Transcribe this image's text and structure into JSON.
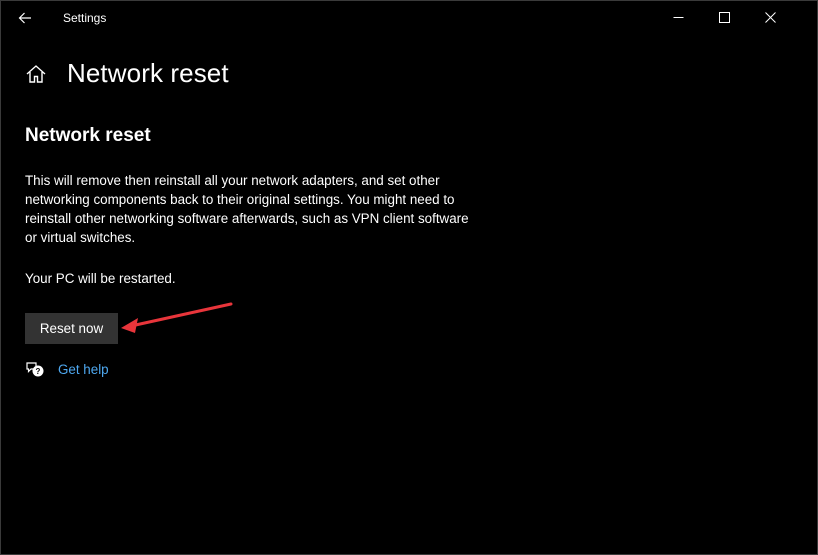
{
  "window": {
    "title": "Settings",
    "controls": {
      "minimize_icon": "minimize-icon",
      "maximize_icon": "maximize-icon",
      "close_icon": "close-icon"
    }
  },
  "header": {
    "back_icon": "back-arrow-icon",
    "home_icon": "home-icon",
    "page_title": "Network reset"
  },
  "main": {
    "section_title": "Network reset",
    "description": "This will remove then reinstall all your network adapters, and set other networking components back to their original settings. You might need to reinstall other networking software afterwards, such as VPN client software or virtual switches.",
    "restart_note": "Your PC will be restarted.",
    "reset_button_label": "Reset now",
    "help_icon": "help-chat-icon",
    "help_link_label": "Get help"
  },
  "colors": {
    "background": "#000000",
    "text": "#ffffff",
    "button_bg": "#333333",
    "link": "#4ea8f0",
    "annotation_arrow": "#e8353b"
  }
}
